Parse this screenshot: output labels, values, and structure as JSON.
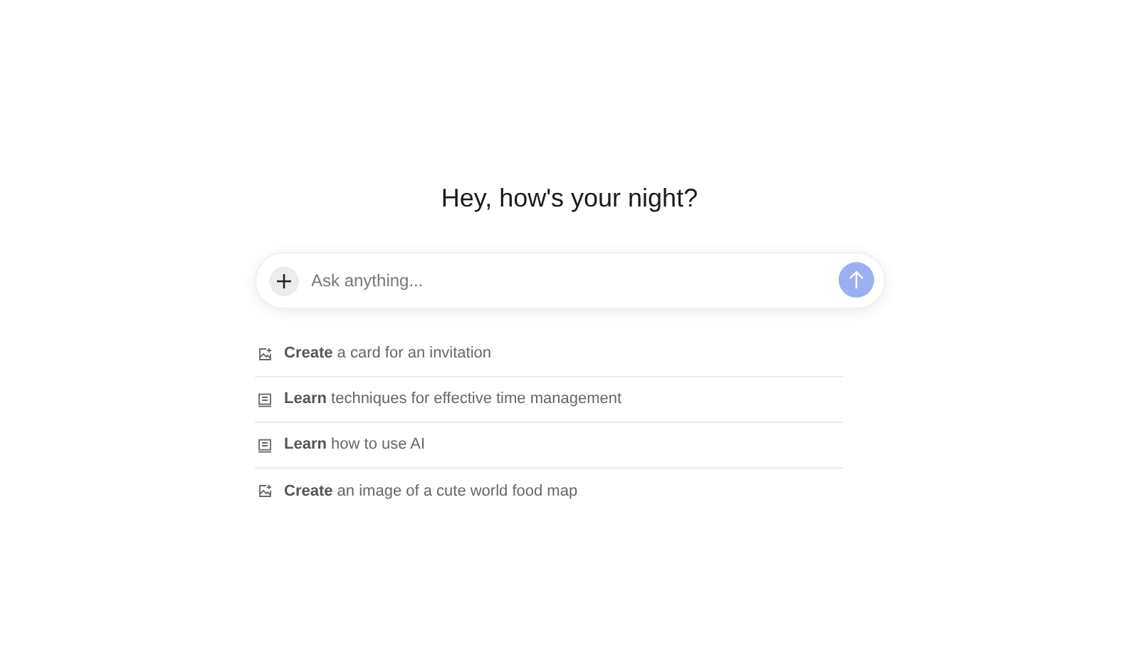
{
  "heading": "Hey, how's your night?",
  "composer": {
    "placeholder": "Ask anything..."
  },
  "suggestions": [
    {
      "kind": "image",
      "text": "**Create** a card for an invitation"
    },
    {
      "kind": "book",
      "text": "**Learn** techniques for effective time management"
    },
    {
      "kind": "book",
      "text": "**Learn** how to use AI"
    },
    {
      "kind": "image",
      "text": "**Create** an image of a cute world food map"
    }
  ]
}
